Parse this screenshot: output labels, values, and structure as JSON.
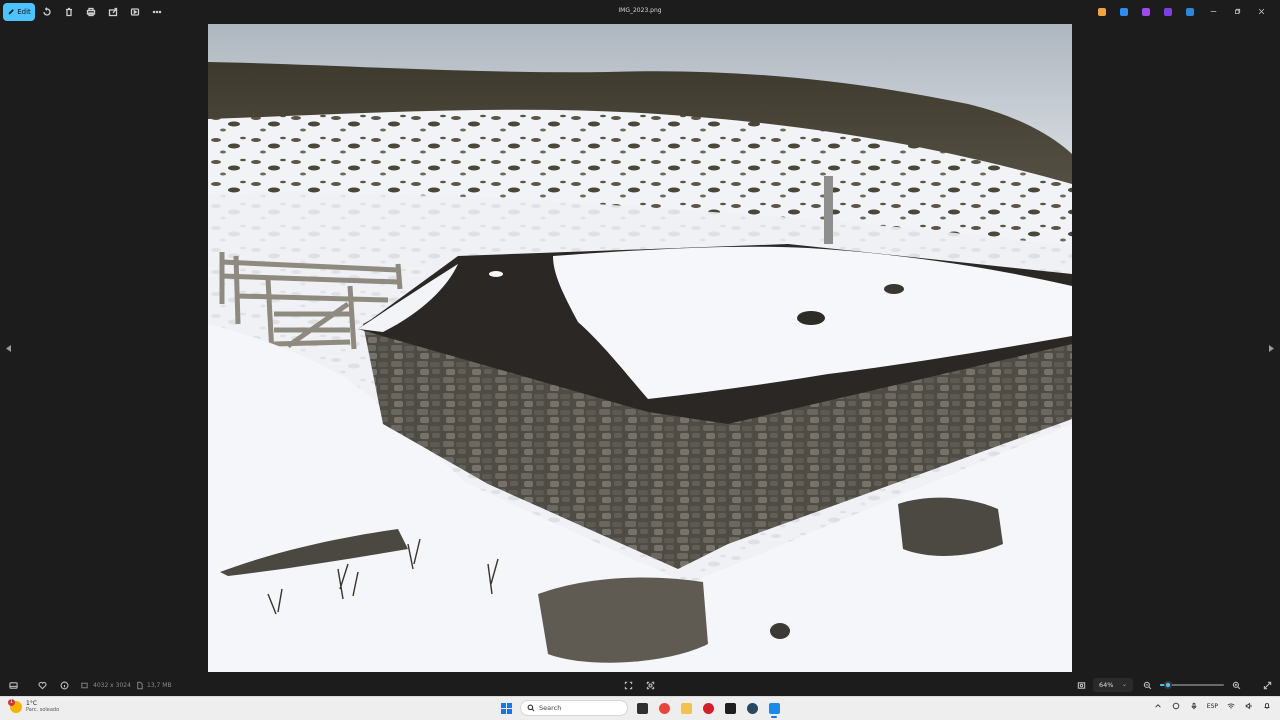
{
  "toolbar": {
    "edit_label": "Edit",
    "file_title": "IMG_2023.png",
    "icons": [
      "rotate-icon",
      "delete-icon",
      "print-icon",
      "share-icon",
      "slideshow-icon",
      "more-icon"
    ],
    "app_icons": [
      {
        "name": "copilot-icon",
        "color": "#f2a33a"
      },
      {
        "name": "designer-icon",
        "color": "#2f8cf0"
      },
      {
        "name": "clipchamp-icon",
        "color": "#9b4de6"
      },
      {
        "name": "clipchamp-video-icon",
        "color": "#7b3fe4"
      },
      {
        "name": "onedrive-icon",
        "color": "#2b88d8"
      }
    ]
  },
  "photo": {
    "description_alt": "Snow-covered stone hut with wooden fence on a mountain slope",
    "colors": {
      "sky": "#b9c0c8",
      "snow": "#f3f5f8",
      "rock": "#4c4a45",
      "roof": "#2b2724"
    }
  },
  "infobar": {
    "dimensions": "4032 x 3024",
    "size": "13,7 MB",
    "zoom": "64%",
    "zoom_fraction": 0.12
  },
  "taskbar": {
    "weather_temp": "1°C",
    "weather_desc": "Parc. soleado",
    "weather_badge": "1",
    "search_placeholder": "Search",
    "language": "ESP",
    "apps": [
      {
        "name": "file-explorer-icon",
        "color": "#2f2f2f",
        "active": false
      },
      {
        "name": "chrome-icon",
        "color": "#e8453c",
        "active": false
      },
      {
        "name": "folder-icon",
        "color": "#f2c14e",
        "active": false
      },
      {
        "name": "opera-icon",
        "color": "#d21f2b",
        "active": false
      },
      {
        "name": "terminal-icon",
        "color": "#1f1f1f",
        "active": false
      },
      {
        "name": "steam-icon",
        "color": "#2a475e",
        "active": false
      },
      {
        "name": "photos-icon",
        "color": "#1a8ae6",
        "active": true
      }
    ]
  }
}
